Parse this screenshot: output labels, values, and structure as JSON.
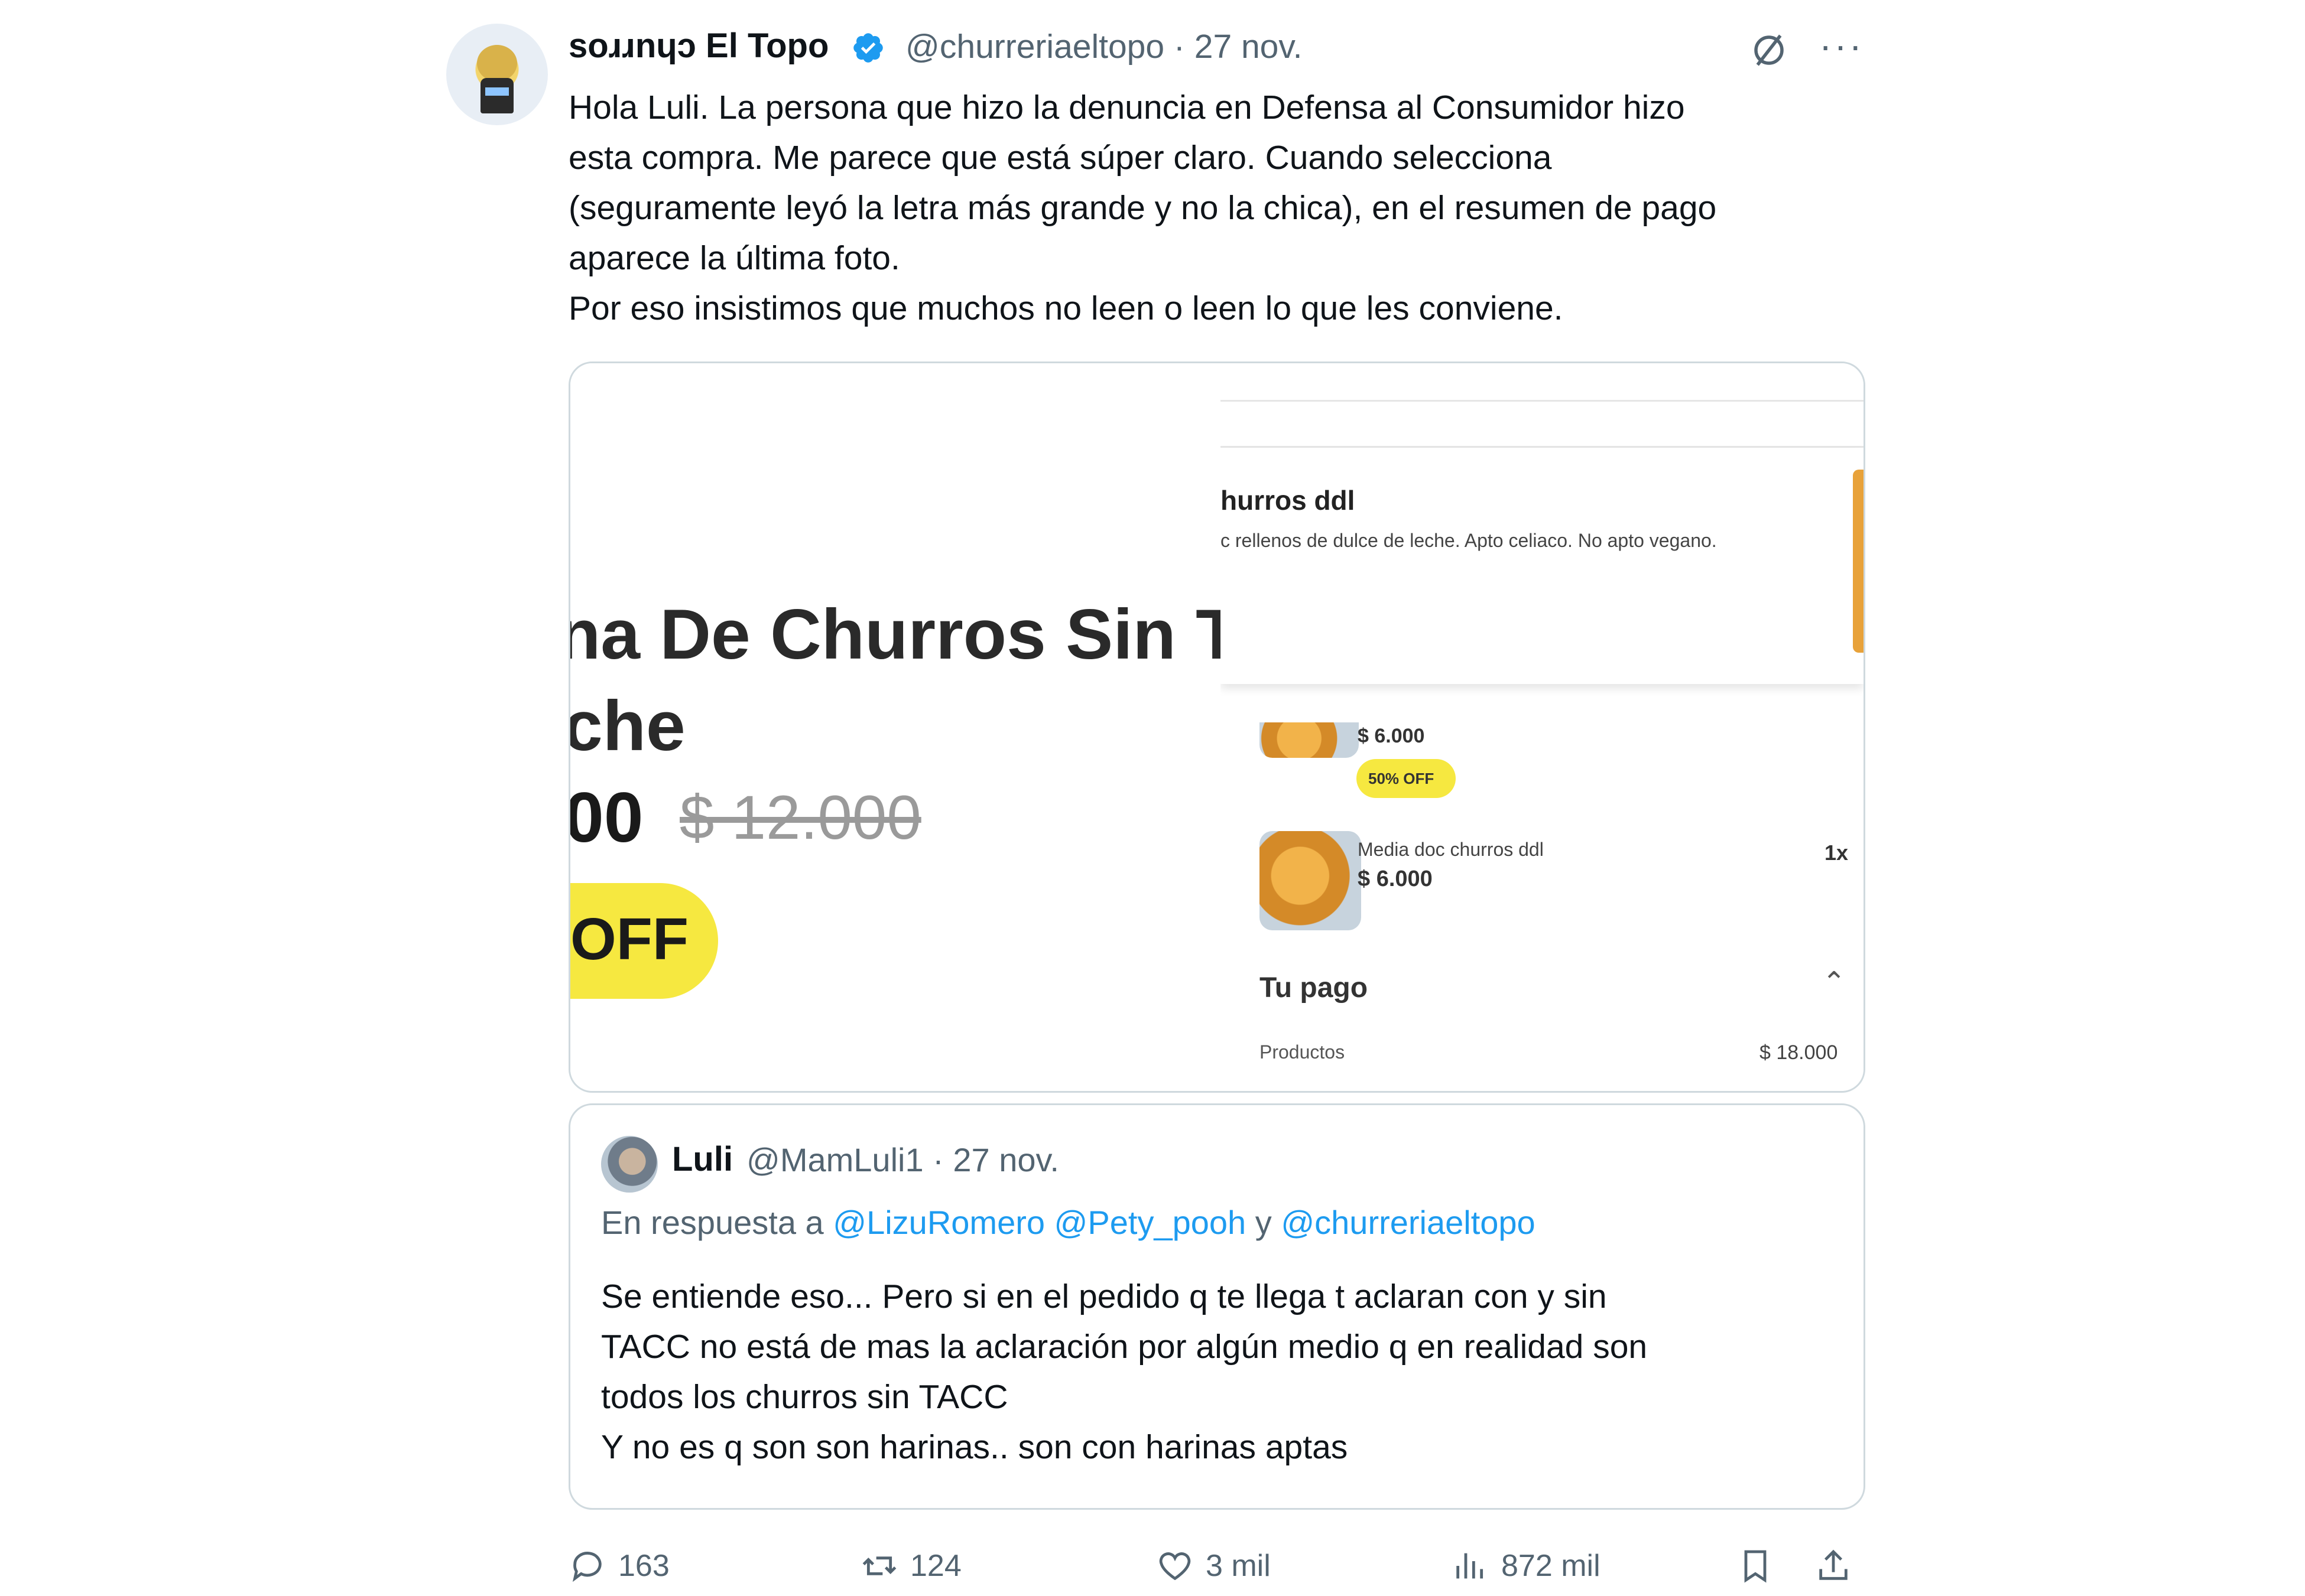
{
  "author": {
    "name": "soɹɹnɥɔ El Topo",
    "handle": "@churreriaeltopo",
    "date": "· 27 nov."
  },
  "tweet": {
    "lines": [
      "Hola Luli. La persona que hizo la denuncia en Defensa al Consumidor hizo",
      "esta compra. Me parece que está súper claro. Cuando selecciona",
      "(seguramente leyó la letra más grande y no la chica), en el resumen de pago",
      "aparece la última foto.",
      "Por eso insistimos que muchos no leen o leen lo que les conviene."
    ]
  },
  "media": {
    "left": {
      "title": "na De Churros Sin Tac",
      "title2": "che",
      "price": "00",
      "old_price": "$ 12.000",
      "badge": "OFF"
    },
    "right": {
      "heading": "hurros ddl",
      "description": "c rellenos de dulce de leche. Apto celiaco. No apto vegano.",
      "price1": "$ 6.000",
      "badge": "50% OFF",
      "item_name": "Media doc churros ddl",
      "item_price": "$ 6.000",
      "item_qty": "1x",
      "payment_title": "Tu pago",
      "products_label": "Productos",
      "products_total": "$ 18.000"
    }
  },
  "quote": {
    "name": "Luli",
    "handle": "@MamLuli1 · 27 nov.",
    "reply_prefix": "En respuesta a",
    "reply_to": "@LizuRomero @Pety_pooh",
    "reply_and": "y",
    "reply_to2": "@churreriaeltopo",
    "lines": [
      "Se entiende eso... Pero si en el pedido q te llega t aclaran con y sin",
      "TACC no está de mas la aclaración por algún medio q en realidad son",
      "todos los churros sin TACC",
      "Y no es q son son harinas.. son con harinas aptas"
    ]
  },
  "actions": {
    "replies": "163",
    "retweets": "124",
    "likes": "3 mil",
    "views": "872 mil"
  },
  "icons": {
    "verified": "verified-badge-icon",
    "grok": "grok-icon",
    "more": "more-icon",
    "reply": "reply-icon",
    "retweet": "retweet-icon",
    "like": "heart-icon",
    "views": "views-icon",
    "bookmark": "bookmark-icon",
    "share": "share-icon"
  },
  "colors": {
    "text": "#0f1419",
    "secondary": "#536471",
    "accent": "#1d9bf0",
    "border": "#cfd9de",
    "promo": "#f6e840"
  }
}
